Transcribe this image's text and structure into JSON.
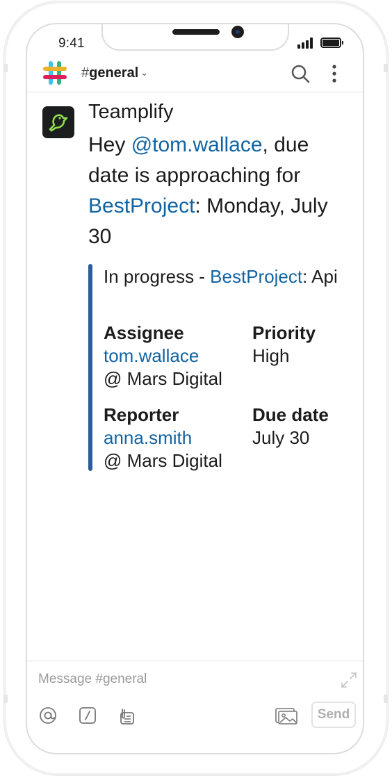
{
  "status_bar": {
    "time": "9:41"
  },
  "header": {
    "channel_hash": "#",
    "channel_name": "general",
    "channel_caret": "⌄"
  },
  "message": {
    "app_name": "Teamplify",
    "text_prefix": "Hey ",
    "mention": "@tom.wallace",
    "text_middle": ", due date is approaching for ",
    "project_link": "BestProject",
    "text_suffix": ": Monday, July 30",
    "attachment": {
      "title_prefix": "In progress - ",
      "title_link": "BestProject",
      "title_suffix": ": Api",
      "fields": {
        "assignee_label": "Assignee",
        "assignee_user": "tom.wallace",
        "assignee_org": "@ Mars Digital",
        "priority_label": "Priority",
        "priority_value": "High",
        "reporter_label": "Reporter",
        "reporter_user": "anna.smith",
        "reporter_org": "@ Mars Digital",
        "due_label": "Due date",
        "due_value": "July 30"
      }
    }
  },
  "composer": {
    "placeholder": "Message #general",
    "send_label": "Send"
  },
  "colors": {
    "link": "#1264a3",
    "attachment_bar": "#2b5e99",
    "avatar_bg": "#1c1d1f",
    "avatar_bird": "#8ee04a"
  },
  "icons": [
    "slack-logo-icon",
    "search-icon",
    "more-vertical-icon",
    "teamplify-bird-icon",
    "expand-icon",
    "at-sign-icon",
    "slash-command-icon",
    "attachment-file-icon",
    "image-gallery-icon"
  ]
}
